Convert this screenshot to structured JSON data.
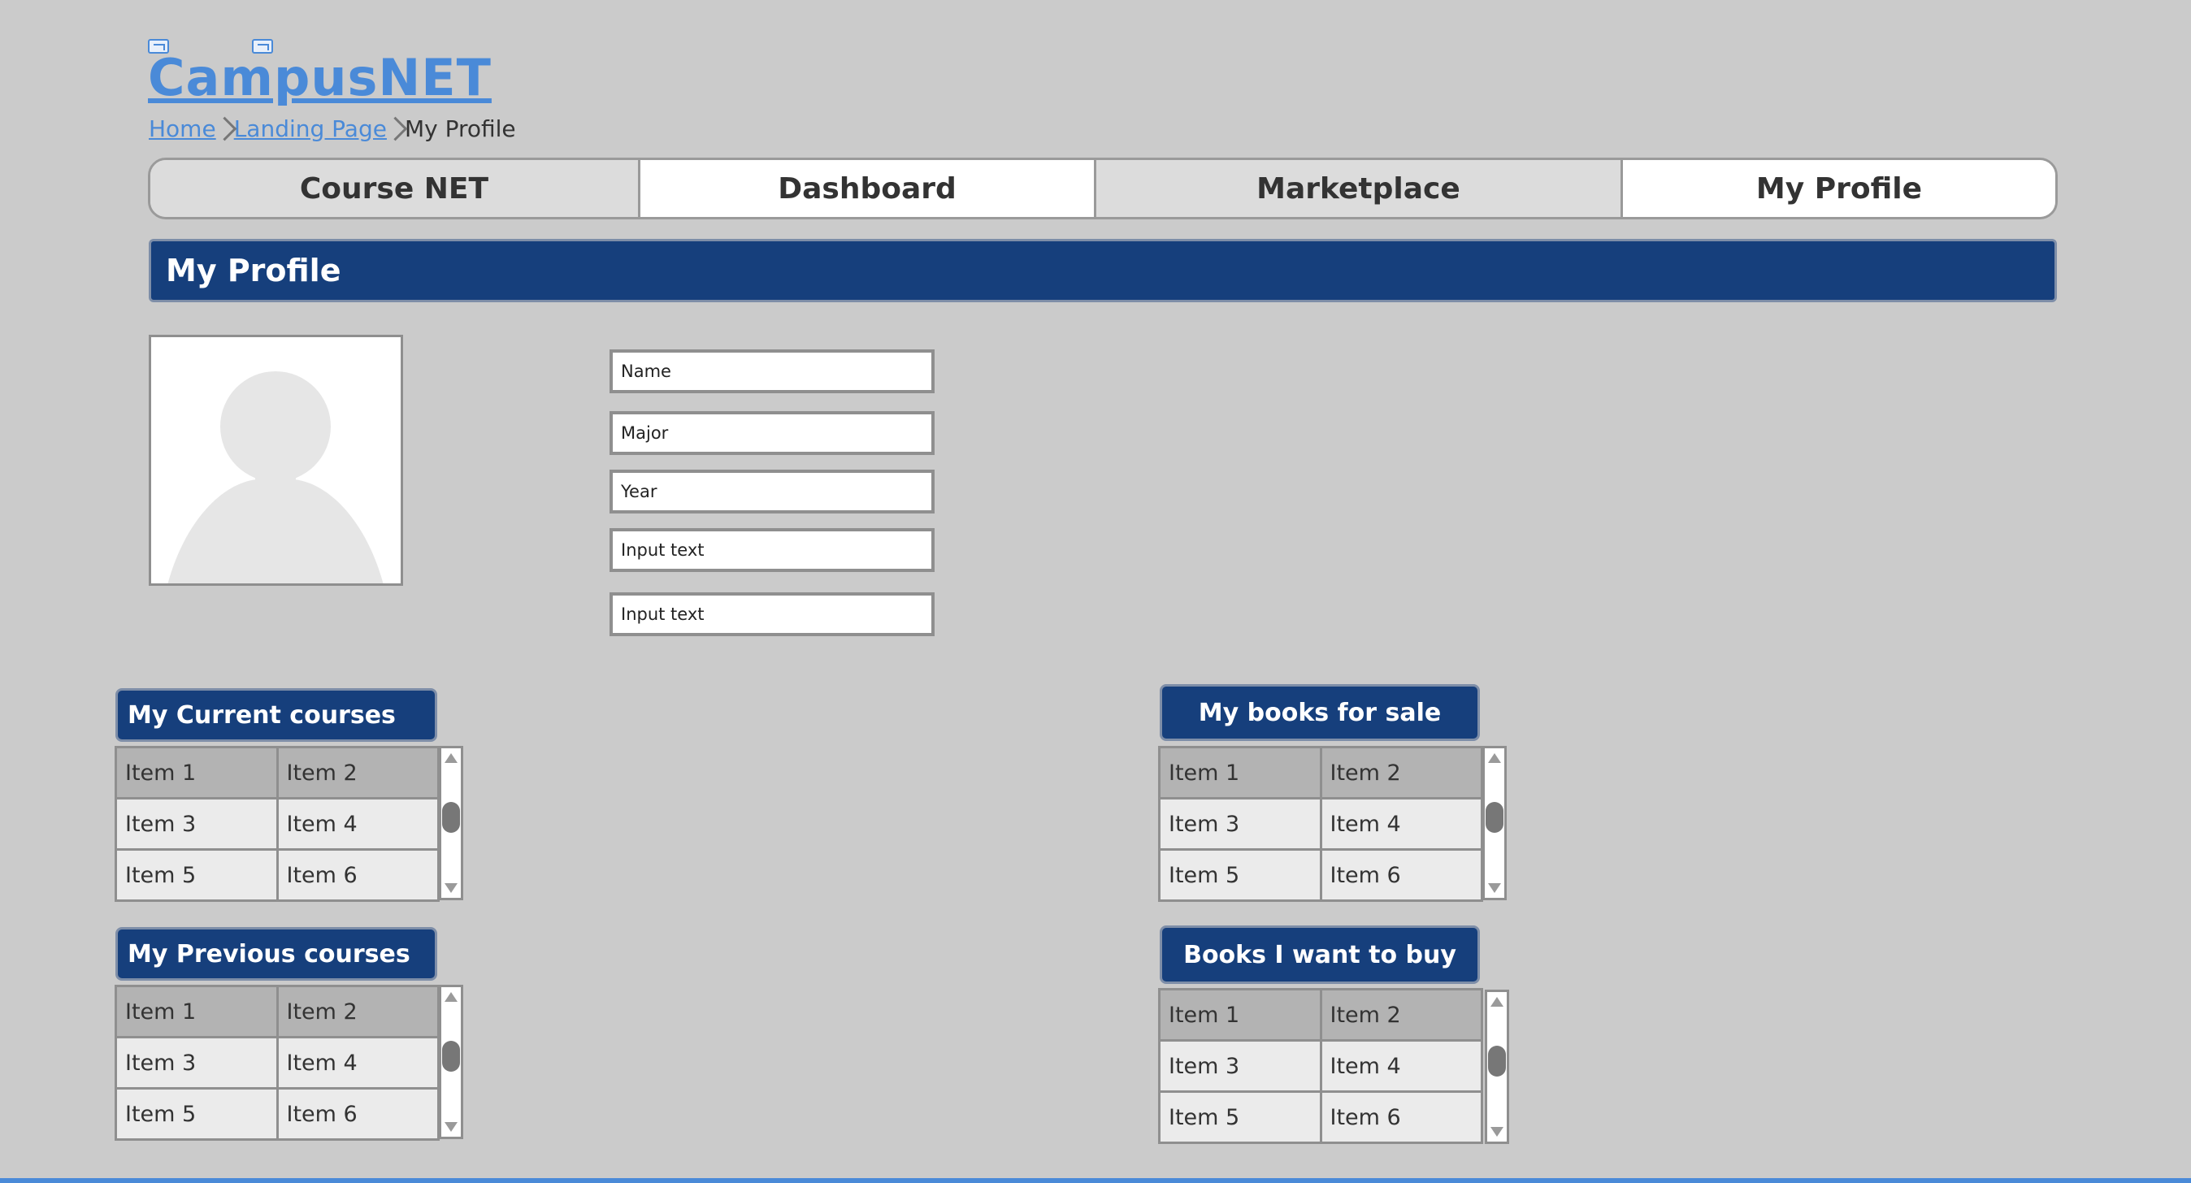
{
  "app": {
    "logo_text": "CampusNET"
  },
  "breadcrumb": {
    "items": [
      {
        "label": "Home"
      },
      {
        "label": "Landing Page"
      }
    ],
    "current": "My Profile"
  },
  "nav": {
    "tabs": [
      {
        "label": "Course NET"
      },
      {
        "label": "Dashboard"
      },
      {
        "label": "Marketplace"
      },
      {
        "label": "My Profile"
      }
    ]
  },
  "page": {
    "title": "My Profile"
  },
  "profile": {
    "fields": [
      {
        "placeholder": "Name",
        "value": ""
      },
      {
        "placeholder": "Major",
        "value": ""
      },
      {
        "placeholder": "Year",
        "value": ""
      },
      {
        "placeholder": "Input text",
        "value": ""
      },
      {
        "placeholder": "Input text",
        "value": ""
      }
    ]
  },
  "sections": {
    "current_courses": {
      "title": "My Current courses",
      "items": [
        "Item 1",
        "Item 2",
        "Item 3",
        "Item 4",
        "Item 5",
        "Item 6"
      ]
    },
    "previous_courses": {
      "title": "My Previous courses",
      "items": [
        "Item 1",
        "Item 2",
        "Item 3",
        "Item 4",
        "Item 5",
        "Item 6"
      ]
    },
    "books_for_sale": {
      "title": "My books for sale",
      "items": [
        "Item 1",
        "Item 2",
        "Item 3",
        "Item 4",
        "Item 5",
        "Item 6"
      ]
    },
    "books_to_buy": {
      "title": "Books I want to buy",
      "items": [
        "Item 1",
        "Item 2",
        "Item 3",
        "Item 4",
        "Item 5",
        "Item 6"
      ]
    }
  },
  "colors": {
    "background": "#cbcbcb",
    "header_blue": "#163f7c",
    "link_blue": "#4a8ad8"
  }
}
